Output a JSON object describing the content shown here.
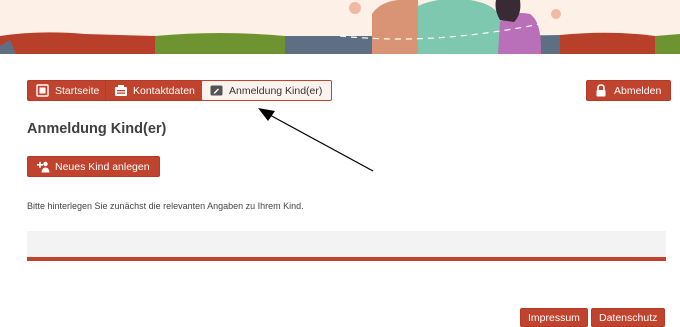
{
  "header": {
    "banner": {
      "colors": {
        "background": "#fdf0e6",
        "bar_red": "#b8402b",
        "bar_green": "#6e9432",
        "bar_slate": "#5e6f83",
        "figure_orange": "#d89474",
        "figure_teal": "#7ec8b0",
        "figure_purple": "#b970b8",
        "hair": "#3a2a35"
      }
    }
  },
  "nav": {
    "startseite": {
      "label": "Startseite",
      "icon": "home-icon",
      "style": "filled"
    },
    "kontaktdaten": {
      "label": "Kontaktdaten",
      "icon": "contact-card-icon",
      "style": "filled"
    },
    "anmeldung": {
      "label": "Anmeldung Kind(er)",
      "icon": "edit-icon",
      "style": "outline-active"
    },
    "abmelden": {
      "label": "Abmelden",
      "icon": "lock-icon",
      "style": "filled"
    }
  },
  "main": {
    "title": "Anmeldung Kind(er)",
    "new_child_button": {
      "label": "Neues Kind anlegen",
      "icon": "add-person-icon"
    },
    "info_text": "Bitte hinterlegen Sie zunächst die relevanten Angaben zu Ihrem Kind."
  },
  "footer": {
    "impressum": "Impressum",
    "datenschutz": "Datenschutz"
  },
  "colors": {
    "accent": "#c0432e",
    "active_bg": "#fdf3ee",
    "box_bg": "#f3f3f3",
    "title": "#404040"
  }
}
